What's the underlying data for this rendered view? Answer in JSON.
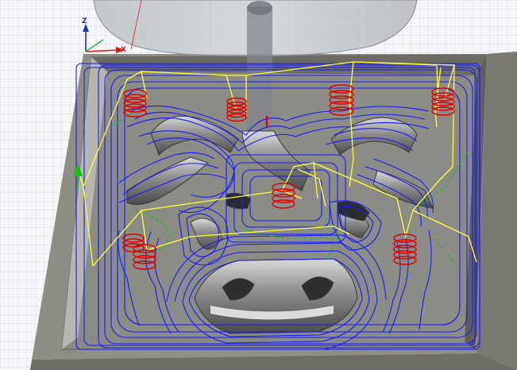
{
  "viewport": {
    "axis_z_label": "Z",
    "axis_x_label": "X",
    "colors": {
      "background": "#f4f6f8",
      "grid_line": "#cfd6de",
      "stock_top": "#8f8e84",
      "stock_wall": "#6f6e66",
      "pocket_floor": "#8a8a84",
      "toolpath_cut": "#1a1aff",
      "toolpath_rapid": "#ffff33",
      "toolpath_lead": "#18b818",
      "plunge_helix": "#e00000",
      "tool_holder": "#9ea2a6",
      "tool_shank": "#80868c",
      "axis_z": "#2030c0",
      "axis_x": "#d02020",
      "axis_y": "#20a020"
    }
  }
}
